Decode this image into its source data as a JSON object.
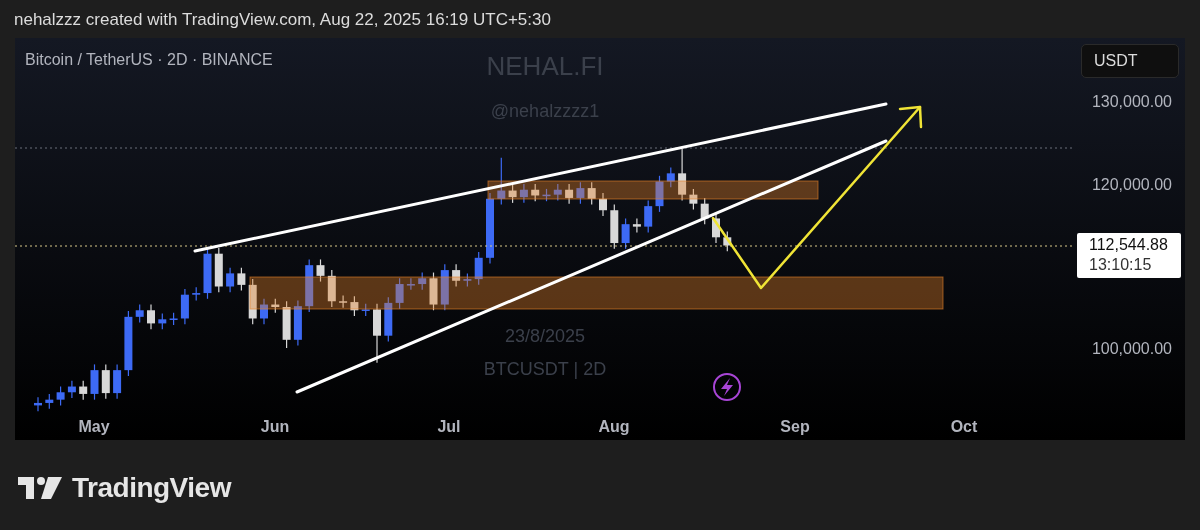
{
  "attribution": "nehalzzz created with TradingView.com, Aug 22, 2025 16:19 UTC+5:30",
  "chart": {
    "legend": "Bitcoin / TetherUS · 2D · BINANCE",
    "currency_button": "USDT",
    "watermark": [
      "NEHAL.FI",
      "@nehalzzzz1",
      "23/8/2025",
      "BTCUSDT | 2D"
    ],
    "price_axis": [
      "130,000.00",
      "120,000.00",
      "100,000.00"
    ],
    "last_price": {
      "price": "112,544.88",
      "countdown": "13:10:15"
    },
    "time_axis": [
      "May",
      "Jun",
      "Jul",
      "Aug",
      "Sep",
      "Oct"
    ]
  },
  "brand": "TradingView"
}
